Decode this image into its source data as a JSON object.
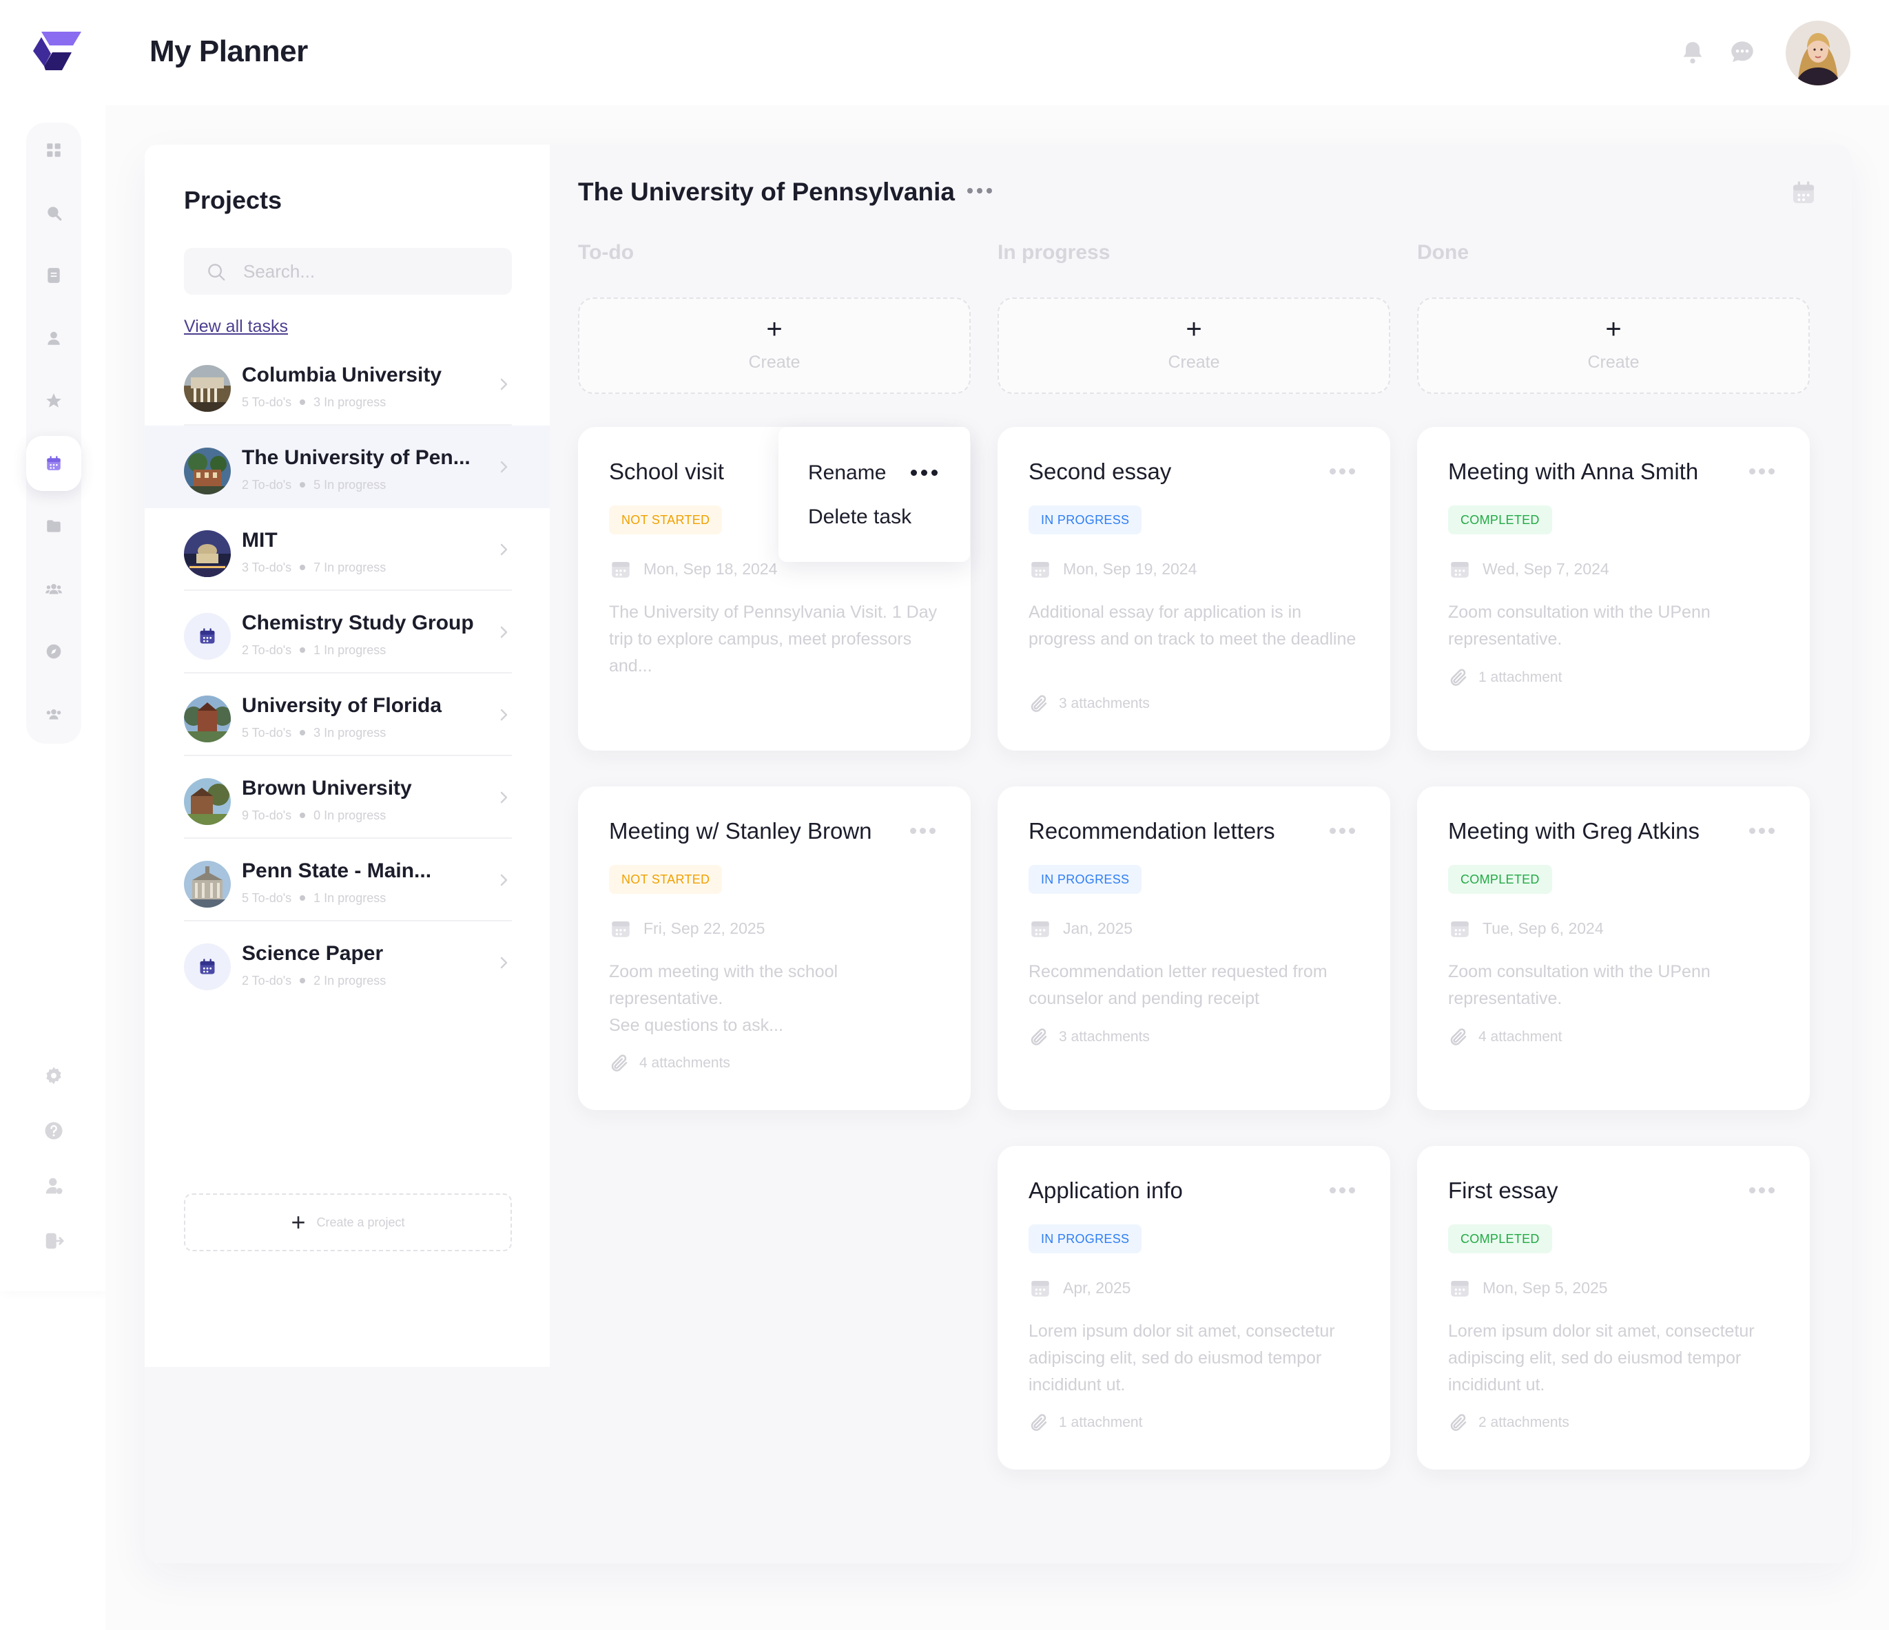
{
  "header": {
    "title": "My Planner",
    "icons": [
      "bell-icon",
      "chat-icon"
    ]
  },
  "sidebar": {
    "items": [
      {
        "icon": "dashboard-grid-icon",
        "active": false
      },
      {
        "icon": "search-icon",
        "active": false
      },
      {
        "icon": "document-icon",
        "active": false
      },
      {
        "icon": "user-icon",
        "active": false
      },
      {
        "icon": "star-icon",
        "active": false
      },
      {
        "icon": "calendar-icon",
        "active": true
      },
      {
        "icon": "folder-icon",
        "active": false
      },
      {
        "icon": "group-icon",
        "active": false
      },
      {
        "icon": "compass-icon",
        "active": false
      },
      {
        "icon": "team-icon",
        "active": false
      }
    ],
    "bottom_items": [
      "settings-icon",
      "help-icon",
      "account-icon",
      "logout-icon"
    ]
  },
  "projects": {
    "title": "Projects",
    "search_placeholder": "Search...",
    "view_all": "View all tasks",
    "create_label": "Create a project",
    "items": [
      {
        "name": "Columbia University",
        "todos": "5 To-do's",
        "progress": "3 In progress",
        "avatar": "photo",
        "color": "#6b5a3e"
      },
      {
        "name": "The University of Pen...",
        "todos": "2 To-do's",
        "progress": "5 In progress",
        "avatar": "photo",
        "color": "#3d5570",
        "selected": true
      },
      {
        "name": "MIT",
        "todos": "3 To-do's",
        "progress": "7 In progress",
        "avatar": "photo",
        "color": "#3a3f7a"
      },
      {
        "name": "Chemistry Study Group",
        "todos": "2 To-do's",
        "progress": "1 In progress",
        "avatar": "calendar"
      },
      {
        "name": "University of Florida",
        "todos": "5 To-do's",
        "progress": "3 In progress",
        "avatar": "photo",
        "color": "#4e6a4a"
      },
      {
        "name": "Brown University",
        "todos": "9 To-do's",
        "progress": "0 In progress",
        "avatar": "photo",
        "color": "#5c6e3b"
      },
      {
        "name": "Penn State - Main...",
        "todos": "5 To-do's",
        "progress": "1 In progress",
        "avatar": "photo",
        "color": "#5b6878"
      },
      {
        "name": "Science Paper",
        "todos": "2 To-do's",
        "progress": "2 In progress",
        "avatar": "calendar"
      }
    ]
  },
  "board": {
    "title": "The University of Pennsylvania",
    "create_label": "Create",
    "columns": [
      {
        "title": "To-do"
      },
      {
        "title": "In progress"
      },
      {
        "title": "Done"
      }
    ],
    "context_menu": {
      "rename": "Rename",
      "delete": "Delete task"
    },
    "cards": {
      "todo_1": {
        "title": "School visit",
        "status": "NOT STARTED",
        "date": "Mon, Sep 18, 2024",
        "desc": "The University of Pennsylvania Visit. 1 Day trip to explore campus, meet professors and..."
      },
      "todo_2": {
        "title": "Meeting w/ Stanley Brown",
        "status": "NOT STARTED",
        "date": "Fri, Sep 22, 2025",
        "desc_1": "Zoom meeting with the school representative.",
        "desc_2": "See questions to ask...",
        "attachments": "4 attachments"
      },
      "prog_1": {
        "title": "Second essay",
        "status": "IN PROGRESS",
        "date": "Mon, Sep 19, 2024",
        "desc": "Additional essay for application is in progress and on track to meet the deadline",
        "attachments": "3 attachments"
      },
      "prog_2": {
        "title": "Recommendation letters",
        "status": "IN PROGRESS",
        "date": "Jan, 2025",
        "desc": "Recommendation letter requested from counselor and pending receipt",
        "attachments": "3 attachments"
      },
      "prog_3": {
        "title": "Application info",
        "status": "IN PROGRESS",
        "date": "Apr, 2025",
        "desc": "Lorem ipsum dolor sit amet, consectetur adipiscing elit, sed do eiusmod tempor incididunt ut.",
        "attachments": "1 attachment"
      },
      "done_1": {
        "title": "Meeting with Anna Smith",
        "status": "COMPLETED",
        "date": "Wed, Sep 7, 2024",
        "desc": "Zoom consultation with the UPenn representative.",
        "attachments": "1 attachment"
      },
      "done_2": {
        "title": "Meeting with Greg Atkins",
        "status": "COMPLETED",
        "date": "Tue, Sep 6, 2024",
        "desc": "Zoom consultation with the UPenn representative.",
        "attachments": "4 attachment"
      },
      "done_3": {
        "title": "First essay",
        "status": "COMPLETED",
        "date": "Mon, Sep 5, 2025",
        "desc": "Lorem ipsum dolor sit amet, consectetur adipiscing elit, sed do eiusmod tempor incididunt ut.",
        "attachments": "2 attachments"
      }
    }
  },
  "colors": {
    "accent": "#6b4fd8",
    "not_started": "#f0a000",
    "in_progress": "#2e7ef5",
    "completed": "#22aa44"
  }
}
